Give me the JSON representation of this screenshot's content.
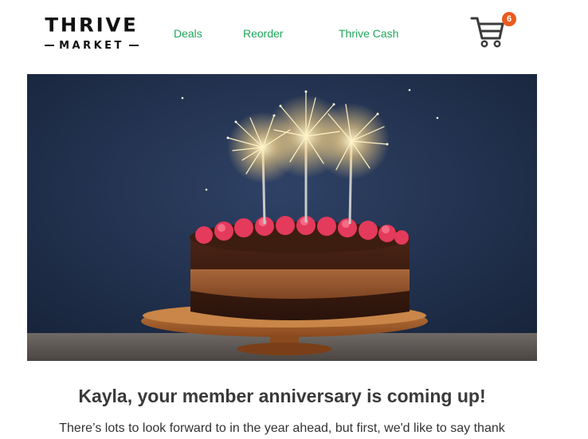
{
  "brand": {
    "logo_top": "THRIVE",
    "logo_bottom": "MARKET"
  },
  "nav": {
    "links": [
      {
        "label": "Deals"
      },
      {
        "label": "Reorder"
      },
      {
        "label": "Thrive Cash"
      }
    ],
    "cart_count": "6",
    "link_color": "#1ea85a",
    "badge_color": "#ea5a1f"
  },
  "hero": {
    "icon": "birthday-cake-with-sparklers-photo"
  },
  "content": {
    "headline": "Kayla, your member anniversary is coming up!",
    "body": "There’s lots to look forward to in the year ahead, but first, we'd like to say thank"
  }
}
